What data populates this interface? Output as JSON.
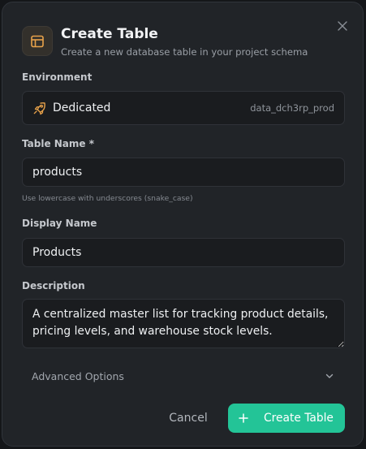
{
  "dialog": {
    "title": "Create Table",
    "subtitle": "Create a new database table in your project schema",
    "header_icon": "table-icon",
    "close_icon": "close-icon"
  },
  "environment": {
    "label": "Environment",
    "icon": "rocket-icon",
    "name": "Dedicated",
    "id": "data_dch3rp_prod"
  },
  "table_name": {
    "label": "Table Name *",
    "value": "products",
    "hint": "Use lowercase with underscores (snake_case)"
  },
  "display_name": {
    "label": "Display Name",
    "value": "Products"
  },
  "description": {
    "label": "Description",
    "value": "A centralized master list for tracking product details, pricing levels, and warehouse stock levels."
  },
  "advanced": {
    "label": "Advanced Options",
    "icon": "chevron-down-icon"
  },
  "actions": {
    "cancel_label": "Cancel",
    "create_label": "Create Table",
    "create_icon": "plus-icon"
  },
  "colors": {
    "accent": "#23c497",
    "icon_accent": "#e8a24a",
    "background": "#212428",
    "field_background": "#1a1c1f"
  }
}
